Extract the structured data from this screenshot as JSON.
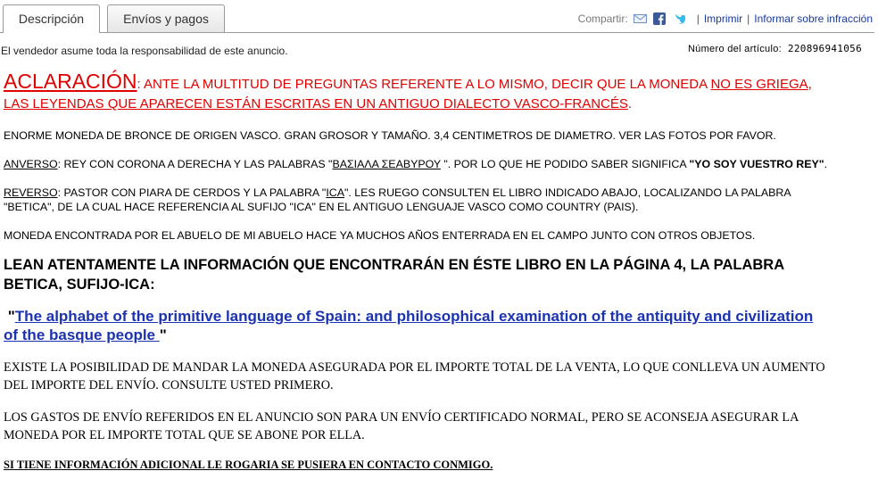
{
  "tabs": {
    "description": "Descripción",
    "shipping": "Envíos y pagos"
  },
  "share": {
    "label": "Compartir:",
    "print": "Imprimir",
    "report": "Informar sobre infracción",
    "icons": [
      "email-icon",
      "facebook-icon",
      "twitter-icon"
    ],
    "colors": {
      "facebook": "#3b5998",
      "twitter": "#33bbee",
      "email": "#6f8fc0"
    }
  },
  "seller_notice": "El vendedor asume toda la responsabilidad de este anuncio.",
  "item_number": {
    "label": "Número del artículo:",
    "value": "220896941056"
  },
  "clarification": {
    "title": "ACLARACIÓN",
    "text1": ": ANTE LA MULTITUD DE PREGUNTAS REFERENTE A LO MISMO, DECIR QUE LA MONEDA ",
    "underline1": "NO ES GRIEGA",
    "text2": ", ",
    "underline2": "LAS LEYENDAS QUE APARECEN ESTÁN ESCRITAS EN UN ANTIGUO DIALECTO VASCO-FRANCÉS",
    "text3": "."
  },
  "intro": "ENORME MONEDA DE BRONCE DE ORIGEN VASCO. GRAN GROSOR Y TAMAÑO. 3,4 CENTIMETROS DE DIAMETRO. VER LAS FOTOS POR FAVOR.",
  "anverso": {
    "label": "ANVERSO",
    "text1": ": REY CON CORONA A DERECHA Y LAS PALABRAS \"",
    "legend": "ΒΑΣΙΑΛΑ ΣΕΑΒΥΡΟΥ",
    "text2": " \". POR LO QUE HE PODIDO SABER SIGNIFICA ",
    "meaning": "\"YO SOY VUESTRO REY\"",
    "text3": "."
  },
  "reverso": {
    "label": "REVERSO",
    "text1": ": PASTOR CON PIARA DE CERDOS Y LA PALABRA \"",
    "word": "ICA",
    "text2": "\". LES RUEGO CONSULTEN EL LIBRO INDICADO ABAJO, LOCALIZANDO LA PALABRA \"BETICA\", DE LA CUAL HACE REFERENCIA AL SUFIJO \"ICA\" EN EL ANTIGUO LENGUAJE VASCO COMO COUNTRY (PAIS)."
  },
  "found": "MONEDA ENCONTRADA POR EL ABUELO DE MI ABUELO HACE YA MUCHOS AÑOS ENTERRADA EN EL CAMPO JUNTO CON OTROS OBJETOS.",
  "lean": "LEAN ATENTAMENTE LA INFORMACIÓN QUE ENCONTRARÁN EN ÉSTE LIBRO EN LA PÁGINA 4, LA PALABRA BETICA, SUFIJO-ICA:",
  "book": {
    "open_quote": " \"",
    "title": "The alphabet of the primitive language of Spain: and philosophical examination of the antiquity and civilization of the basque people ",
    "close_quote": "\""
  },
  "insurance": "EXISTE LA POSIBILIDAD DE MANDAR LA MONEDA ASEGURADA POR EL IMPORTE TOTAL DE LA VENTA, LO QUE CONLLEVA UN AUMENTO DEL IMPORTE DEL ENVÍO. CONSULTE USTED PRIMERO.",
  "shipping_note": "LOS GASTOS DE ENVÍO REFERIDOS EN EL ANUNCIO SON PARA UN ENVÍO CERTIFICADO NORMAL, PERO SE ACONSEJA ASEGURAR LA MONEDA POR EL IMPORTE TOTAL QUE SE ABONE POR ELLA.",
  "contact": "SI TIENE INFORMACIÓN ADICIONAL LE ROGARIA SE PUSIERA EN CONTACTO CONMIGO."
}
